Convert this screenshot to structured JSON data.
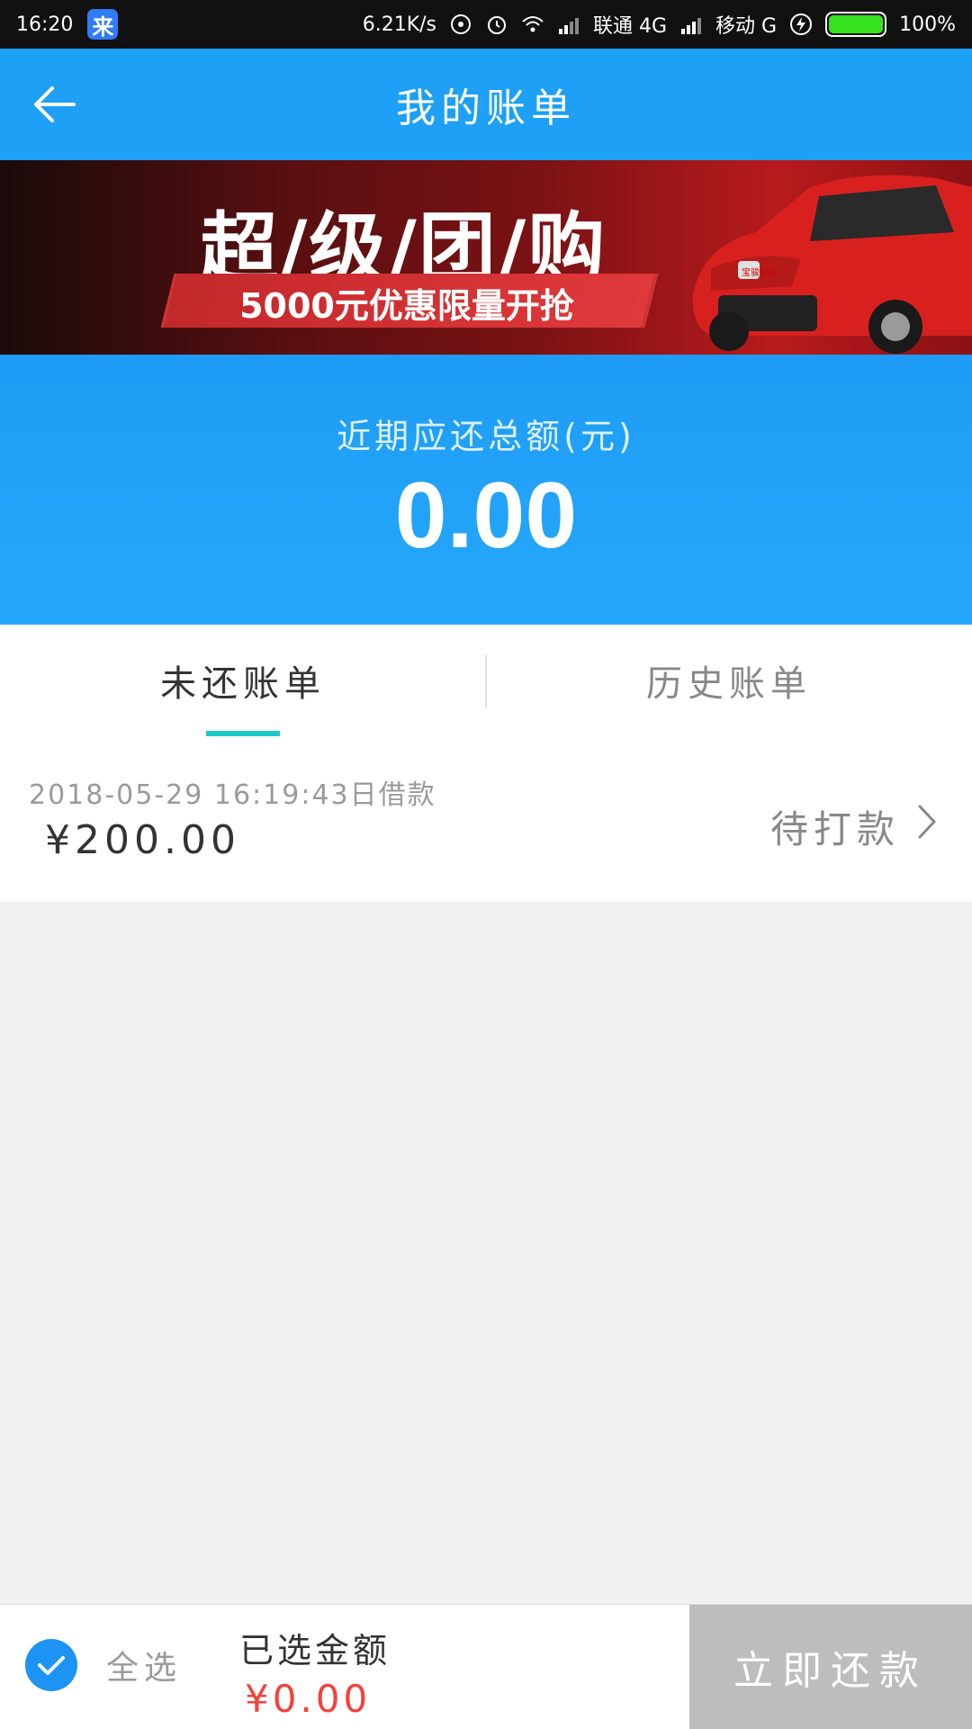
{
  "status_bar": {
    "time": "16:20",
    "app_badge": "来",
    "speed": "6.21K/s",
    "carrier1": "联通 4G",
    "carrier2": "移动 G",
    "battery": "100%",
    "battery_level": 1.0,
    "battery_color": "#37e21f"
  },
  "header": {
    "title": "我的账单",
    "back_icon": "arrow-left-icon"
  },
  "banner": {
    "headline": "超/级/团/购",
    "subline": "5000元优惠限量开抢",
    "car_plate": "宝骏510"
  },
  "summary": {
    "label": "近期应还总额(元)",
    "amount": "0.00"
  },
  "tabs": [
    {
      "label": "未还账单",
      "active": true
    },
    {
      "label": "历史账单",
      "active": false
    }
  ],
  "bills": [
    {
      "date": "2018-05-29 16:19:43日借款",
      "amount": "¥200.00",
      "status": "待打款",
      "icon": "chevron-right-icon"
    }
  ],
  "bottom_bar": {
    "select_all_label": "全选",
    "selected_label": "已选金额",
    "selected_amount": "¥0.00",
    "pay_button": "立即还款"
  },
  "colors": {
    "primary": "#1da0f5",
    "tab_indicator": "#1fc9c7",
    "amount_red": "#f5403a",
    "disabled_button": "#bdbdbd"
  }
}
